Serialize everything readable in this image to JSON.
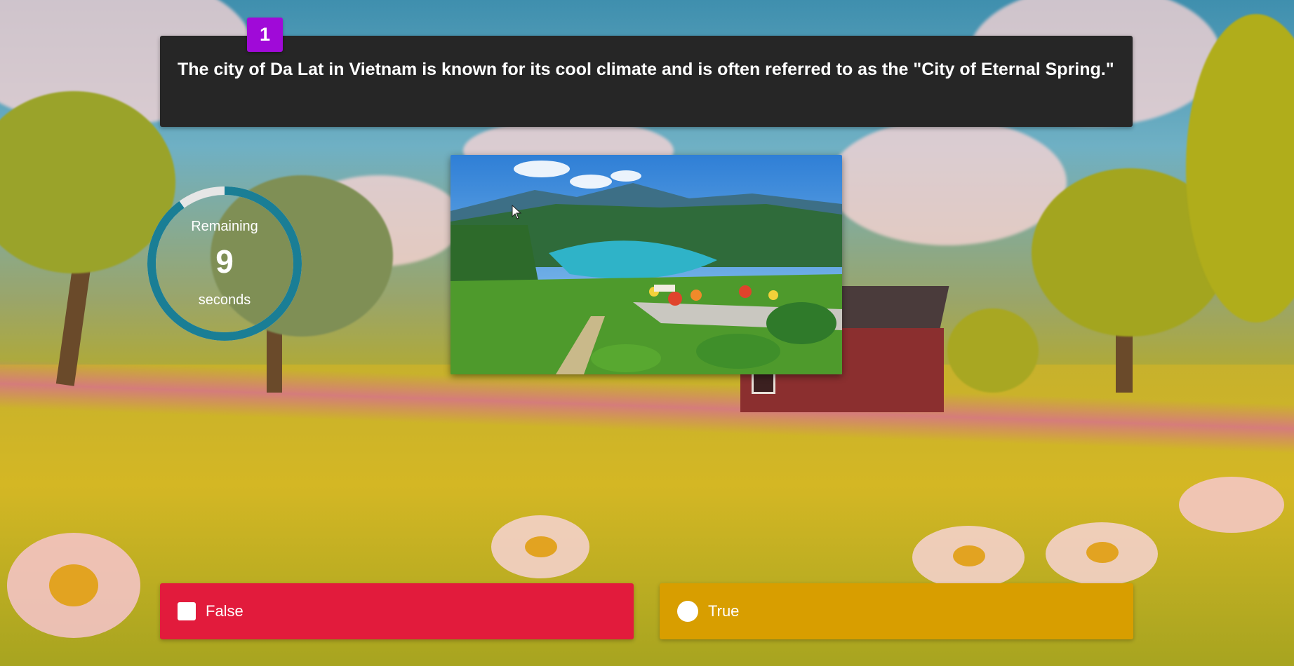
{
  "question": {
    "number": "1",
    "text": "The city of Da Lat in Vietnam is known for its cool climate and is often referred to as the \"City of Eternal Spring.\""
  },
  "timer": {
    "label_top": "Remaining",
    "value": "9",
    "label_bottom": "seconds",
    "remaining_fraction": 0.9,
    "ring_color": "#1a7e95",
    "track_color": "#e6e6e6"
  },
  "image": {
    "description_icon": "landscape-photo"
  },
  "answers": [
    {
      "label": "False",
      "shape": "square-icon",
      "color": "#e21b3c"
    },
    {
      "label": "True",
      "shape": "circle-icon",
      "color": "#d89e00"
    }
  ],
  "colors": {
    "question_card": "#262626",
    "badge": "#a00ad8"
  }
}
